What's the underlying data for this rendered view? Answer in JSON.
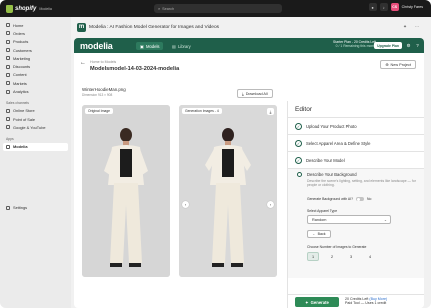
{
  "topbar": {
    "brand": "shopify",
    "env": "Modelia",
    "search_placeholder": "Search",
    "user_initials": "CS",
    "user_name": "Christy Fares"
  },
  "sidebar": {
    "items": [
      {
        "label": "Home"
      },
      {
        "label": "Orders"
      },
      {
        "label": "Products"
      },
      {
        "label": "Customers"
      },
      {
        "label": "Marketing"
      },
      {
        "label": "Discounts"
      },
      {
        "label": "Content"
      },
      {
        "label": "Markets"
      },
      {
        "label": "Analytics"
      }
    ],
    "sales_channels_label": "Sales channels",
    "channels": [
      {
        "label": "Online Store"
      },
      {
        "label": "Point of Sale"
      },
      {
        "label": "Google & YouTube"
      }
    ],
    "apps_label": "Apps",
    "apps": [
      {
        "label": "Modelia"
      }
    ],
    "settings_label": "Settings"
  },
  "app_header": {
    "icon_letter": "m",
    "title": "Modelia : AI Fashion Model Generator for Images and Videos"
  },
  "appnav": {
    "brand": "modelia",
    "tabs": [
      {
        "label": "Models"
      },
      {
        "label": "Library"
      }
    ],
    "plan_line1": "Starter Plan - 20 Credits Left",
    "plan_line2": "0 / 1 Remaining this month",
    "upgrade_label": "Upgrade Plan"
  },
  "crumbs": {
    "back_to": "Home to Models",
    "title": "Modelsmodel-14-03-2024-modelia",
    "new_project_label": "New Project"
  },
  "image_area": {
    "file_name": "WinterHoodieMan.png",
    "file_sub": "Dimension 913 × 908",
    "download_all_label": "Download All",
    "original_label": "Original Image",
    "generated_label": "Generation Images - 4"
  },
  "editor": {
    "title": "Editor",
    "steps": [
      {
        "label": "Upload Your Product Photo"
      },
      {
        "label": "Select Apparel Area & Define Style"
      },
      {
        "label": "Describe Your Model"
      }
    ],
    "active_step": {
      "title": "Describe Your Background",
      "description": "Describe the scene's lighting, setting, and elements like landscape — for people or clothing.",
      "gen_ai_label": "Generate Background with AI?",
      "gen_ai_value": "No",
      "apparel_type_label": "Select Apparel Type",
      "apparel_type_value": "Random",
      "back_label": "Back",
      "num_images_label": "Choose Number of Images to Generate",
      "num_options": [
        "1",
        "2",
        "3",
        "4"
      ],
      "selected_num": "1"
    },
    "generate_label": "Generate",
    "credits_line1": "20 Credits Left",
    "buy_more": "(Buy More)",
    "credits_line2": "Paid Tool — Uses 1 credit"
  },
  "colors": {
    "brand_green": "#1f5f4a",
    "generate_green": "#2e8b57",
    "topbar": "#1a1a1a"
  }
}
